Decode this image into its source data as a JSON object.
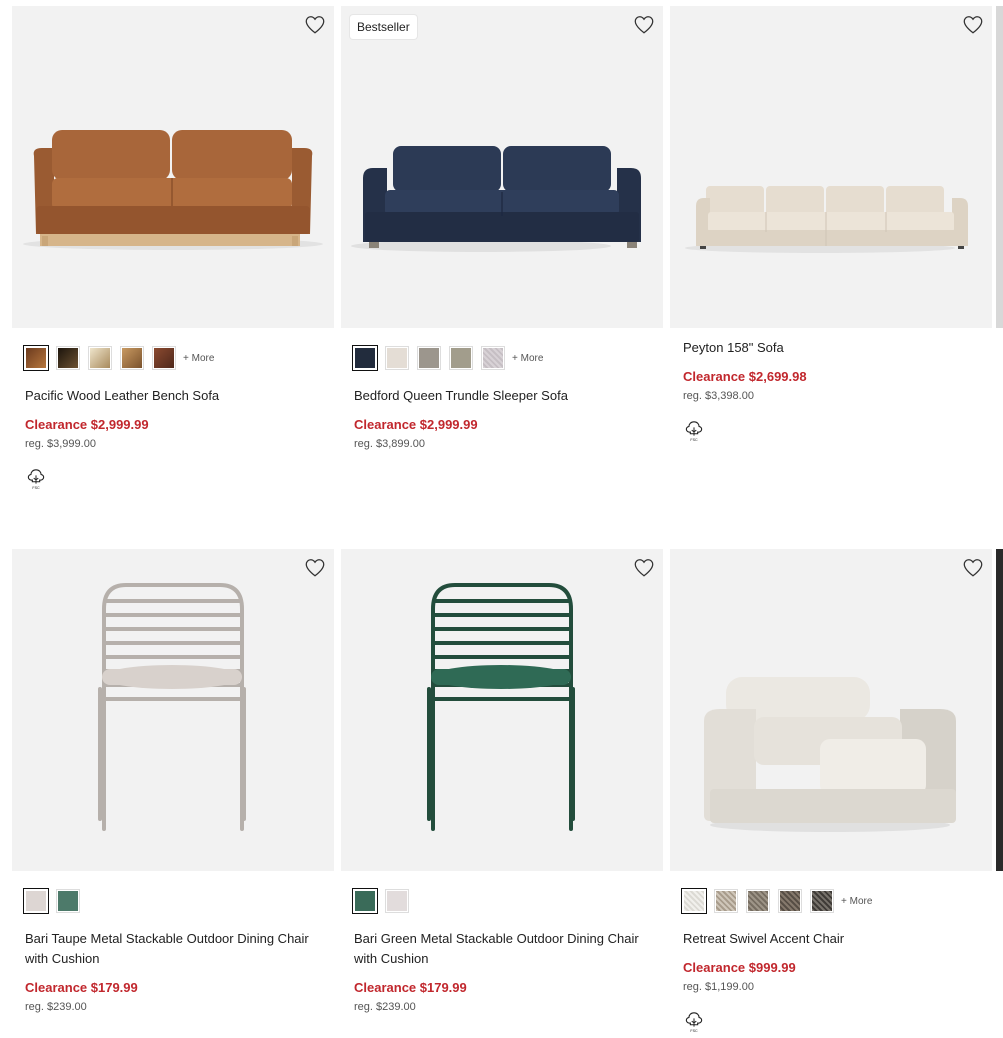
{
  "products": [
    {
      "name": "Pacific Wood Leather Bench Sofa",
      "badge": "",
      "more_label": "+ More",
      "price_label": "Clearance $2,999.99",
      "reg_label": "reg. $3,999.00",
      "swatch_colors": [
        "#8a4f2a",
        "#2b2015",
        "#d9c7a0",
        "#a0703f",
        "#6a3a26"
      ],
      "has_fsc": true,
      "icon": "sofa-leather-image"
    },
    {
      "name": "Bedford Queen Trundle Sleeper Sofa",
      "badge": "Bestseller",
      "more_label": "+ More",
      "price_label": "Clearance $2,999.99",
      "reg_label": "reg. $3,899.00",
      "swatch_colors": [
        "#222c3d",
        "#e4ddd5",
        "#9c968d",
        "#a29d8c",
        "#d8d2d6"
      ],
      "has_fsc": false,
      "icon": "sofa-navy-image"
    },
    {
      "name": "Peyton 158\" Sofa",
      "badge": "",
      "more_label": "",
      "price_label": "Clearance $2,699.98",
      "reg_label": "reg. $3,398.00",
      "swatch_colors": [],
      "has_fsc": true,
      "icon": "sofa-cream-image"
    },
    {
      "name": "Bari Taupe Metal Stackable Outdoor Dining Chair with Cushion",
      "badge": "",
      "more_label": "",
      "price_label": "Clearance $179.99",
      "reg_label": "reg. $239.00",
      "swatch_colors": [
        "#ddd6d3",
        "#4d7a6a"
      ],
      "has_fsc": false,
      "icon": "chair-taupe-image"
    },
    {
      "name": "Bari Green Metal Stackable Outdoor Dining Chair with Cushion",
      "badge": "",
      "more_label": "",
      "price_label": "Clearance $179.99",
      "reg_label": "reg. $239.00",
      "swatch_colors": [
        "#3a6b59",
        "#e2dcdc"
      ],
      "has_fsc": false,
      "icon": "chair-green-image"
    },
    {
      "name": "Retreat Swivel Accent Chair",
      "badge": "",
      "more_label": "+ More",
      "price_label": "Clearance $999.99",
      "reg_label": "reg. $1,199.00",
      "swatch_colors": [
        "#ecebe7",
        "#bdb2a4",
        "#8b8276",
        "#6f665c",
        "#5a5550"
      ],
      "has_fsc": true,
      "icon": "accent-chair-image"
    }
  ],
  "colors": {
    "clearance": "#c1272d",
    "text": "#222222",
    "image_bg": "#f2f2f2"
  }
}
